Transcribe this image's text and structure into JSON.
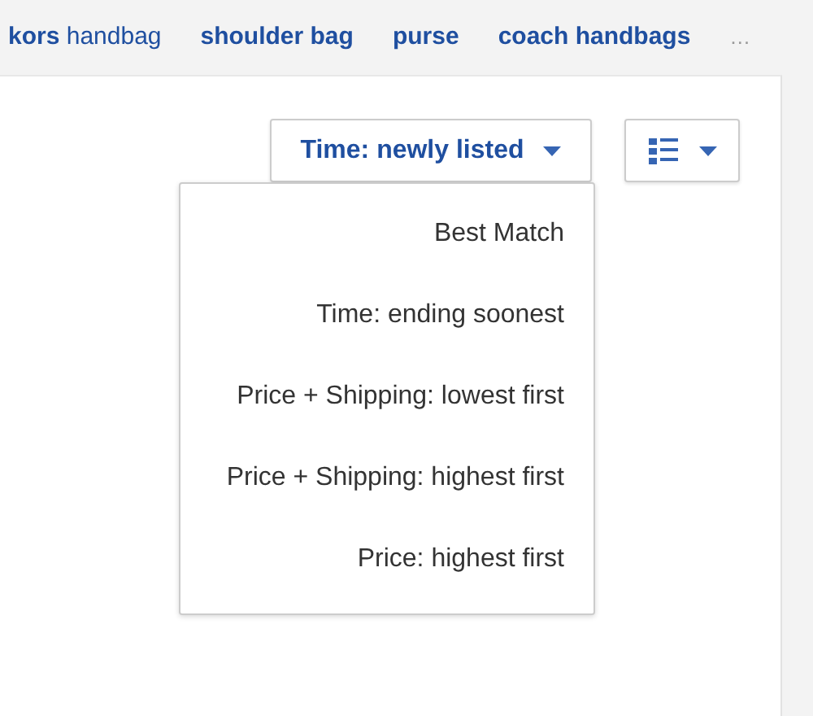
{
  "related_searches": [
    {
      "label": "**kors** handbag"
    },
    {
      "label": "shoulder bag"
    },
    {
      "label": "purse"
    },
    {
      "label": "coach handbags"
    }
  ],
  "more": "…",
  "sort": {
    "label": "Time: newly listed",
    "expanded": true,
    "options": [
      {
        "label": "Best Match"
      },
      {
        "label": "Time: ending soonest"
      },
      {
        "label": "Price + Shipping: lowest first"
      },
      {
        "label": "Price + Shipping: highest first"
      },
      {
        "label": "Price: highest first"
      }
    ]
  }
}
